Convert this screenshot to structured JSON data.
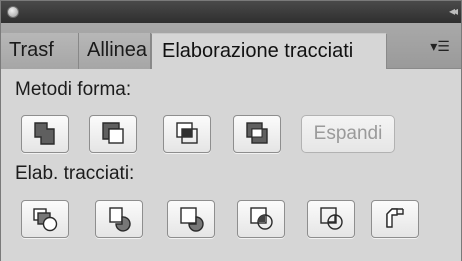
{
  "tabs": [
    {
      "label": "Trasf",
      "active": false
    },
    {
      "label": "Allinea",
      "active": false
    },
    {
      "label": "Elaborazione tracciati",
      "active": true
    }
  ],
  "shape_modes": {
    "label": "Metodi forma:",
    "buttons": [
      {
        "icon": "unite-icon"
      },
      {
        "icon": "minus-front-icon"
      },
      {
        "icon": "intersect-icon"
      },
      {
        "icon": "exclude-icon"
      }
    ],
    "expand_label": "Espandi"
  },
  "pathfinders": {
    "label": "Elab. tracciati:",
    "buttons": [
      {
        "icon": "divide-icon"
      },
      {
        "icon": "trim-icon"
      },
      {
        "icon": "merge-icon"
      },
      {
        "icon": "crop-icon"
      },
      {
        "icon": "outline-icon"
      },
      {
        "icon": "minus-back-icon"
      }
    ]
  }
}
